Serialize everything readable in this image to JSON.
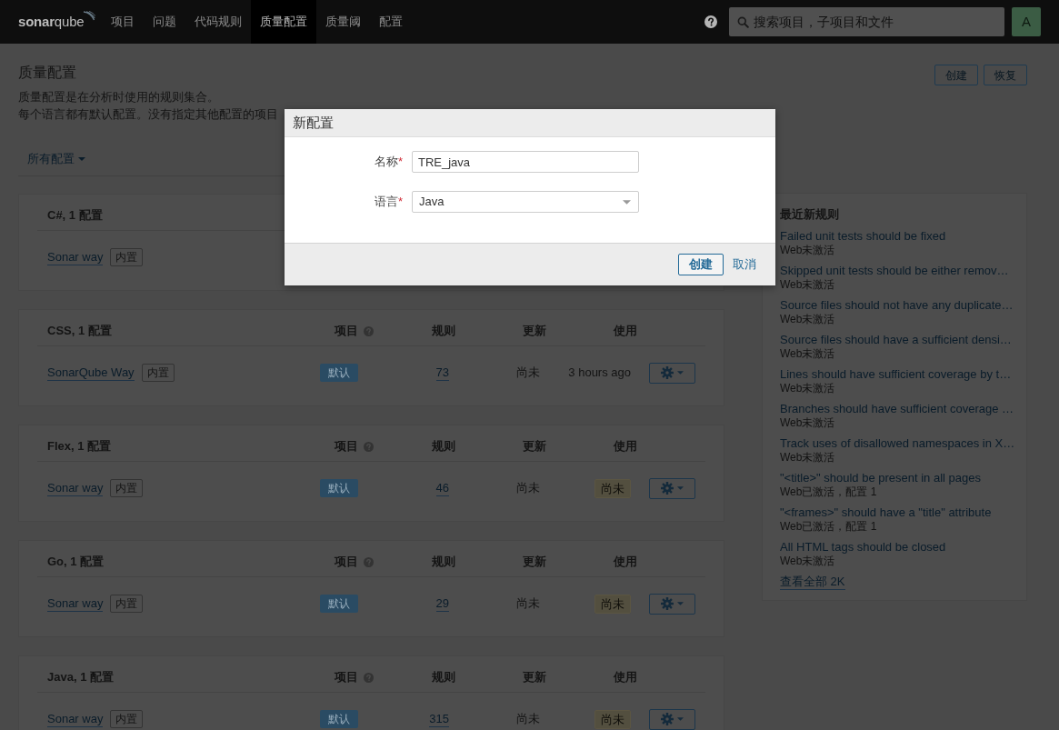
{
  "nav": {
    "logo": "**sonar**qube",
    "items": [
      {
        "label": "项目",
        "selected": false
      },
      {
        "label": "问题",
        "selected": false
      },
      {
        "label": "代码规则",
        "selected": false
      },
      {
        "label": "质量配置",
        "selected": true
      },
      {
        "label": "质量阈",
        "selected": false
      },
      {
        "label": "配置",
        "selected": false
      }
    ],
    "search": {
      "placeholder": "搜索项目，子项目和文件"
    },
    "avatar": "A"
  },
  "page": {
    "title": "质量配置",
    "description": [
      "质量配置是在分析时使用的规则集合。",
      "每个语言都有默认配置。没有指定其他配置的项目"
    ],
    "actions": [
      "创建",
      "恢复"
    ],
    "filter": "所有配置"
  },
  "profiles": [
    {
      "title": "C#, 1 配置",
      "rows": [
        {
          "name": "Sonar way",
          "tag": "内置"
        }
      ]
    },
    {
      "title": "CSS, 1 配置",
      "columns": [
        {
          "label": "项目",
          "help": true
        },
        {
          "label": "规则",
          "help": false
        },
        {
          "label": "更新",
          "help": false
        },
        {
          "label": "使用",
          "help": false
        }
      ],
      "rows": [
        {
          "name": "SonarQube Way",
          "tag": "内置",
          "project_badge": "默认",
          "rules": "73",
          "updated": "尚未",
          "used": {
            "kind": "text",
            "text": "3 hours ago"
          },
          "menu": true
        }
      ]
    },
    {
      "title": "Flex, 1 配置",
      "columns": [
        {
          "label": "项目",
          "help": true
        },
        {
          "label": "规则",
          "help": false
        },
        {
          "label": "更新",
          "help": false
        },
        {
          "label": "使用",
          "help": false
        }
      ],
      "rows": [
        {
          "name": "Sonar way",
          "tag": "内置",
          "project_badge": "默认",
          "rules": "46",
          "updated": "尚未",
          "used": {
            "kind": "badge",
            "text": "尚未"
          },
          "menu": true
        }
      ]
    },
    {
      "title": "Go, 1 配置",
      "columns": [
        {
          "label": "项目",
          "help": true
        },
        {
          "label": "规则",
          "help": false
        },
        {
          "label": "更新",
          "help": false
        },
        {
          "label": "使用",
          "help": false
        }
      ],
      "rows": [
        {
          "name": "Sonar way",
          "tag": "内置",
          "project_badge": "默认",
          "rules": "29",
          "updated": "尚未",
          "used": {
            "kind": "badge",
            "text": "尚未"
          },
          "menu": true
        }
      ]
    },
    {
      "title": "Java, 1 配置",
      "columns": [
        {
          "label": "项目",
          "help": true
        },
        {
          "label": "规则",
          "help": false
        },
        {
          "label": "更新",
          "help": false
        },
        {
          "label": "使用",
          "help": false
        }
      ],
      "rows": [
        {
          "name": "Sonar way",
          "tag": "内置",
          "project_badge": "默认",
          "rules": "315",
          "updated": "尚未",
          "used": {
            "kind": "badge",
            "text": "尚未"
          },
          "menu": true
        }
      ]
    }
  ],
  "sidebar": {
    "title": "最近新规则",
    "rules": [
      {
        "name": "Failed unit tests should be fixed",
        "status": "Web未激活"
      },
      {
        "name": "Skipped unit tests should be either remov…",
        "status": "Web未激活"
      },
      {
        "name": "Source files should not have any duplicate…",
        "status": "Web未激活"
      },
      {
        "name": "Source files should have a sufficient densi…",
        "status": "Web未激活"
      },
      {
        "name": "Lines should have sufficient coverage by t…",
        "status": "Web未激活"
      },
      {
        "name": "Branches should have sufficient coverage …",
        "status": "Web未激活"
      },
      {
        "name": "Track uses of disallowed namespaces in X…",
        "status": "Web未激活"
      },
      {
        "name": "\"<title>\" should be present in all pages",
        "status": "Web已激活，配置 1"
      },
      {
        "name": "\"<frames>\" should have a \"title\" attribute",
        "status": "Web已激活，配置 1"
      },
      {
        "name": "All HTML tags should be closed",
        "status": "Web未激活"
      }
    ],
    "view_all": "查看全部 2K"
  },
  "dialog": {
    "title": "新配置",
    "fields": [
      {
        "kind": "text",
        "label": "名称",
        "required_mark": "*",
        "value": "TRE_java"
      },
      {
        "kind": "select",
        "label": "语言",
        "required_mark": "*",
        "value": "Java"
      }
    ],
    "buttons": [
      {
        "kind": "primary",
        "label": "创建"
      },
      {
        "kind": "link",
        "label": "取消"
      }
    ]
  }
}
